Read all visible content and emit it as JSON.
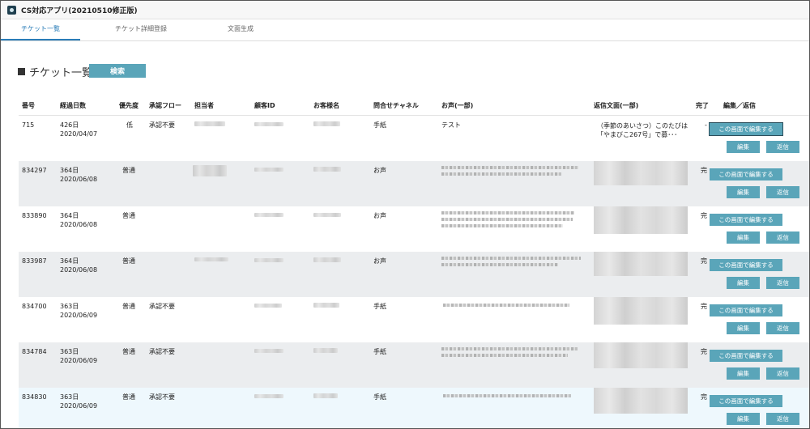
{
  "app": {
    "title": "CS対応アプリ(20210510修正版)"
  },
  "tabs": [
    {
      "label": "チケット一覧"
    },
    {
      "label": "チケット詳細登録"
    },
    {
      "label": "文面生成"
    }
  ],
  "page": {
    "title": "チケット一覧",
    "search_label": "検索"
  },
  "table": {
    "headers": [
      "番号",
      "経過日数",
      "優先度",
      "承認フロー",
      "担当者",
      "顧客ID",
      "お客様名",
      "問合せチャネル",
      "お声(一部)",
      "返信文面(一部)",
      "完了",
      "編集／返信"
    ],
    "buttons": {
      "edit_here": "この画面で編集する",
      "edit": "編集",
      "reply": "返信"
    },
    "rows": [
      {
        "number": "715",
        "days": "426日",
        "date": "2020/04/07",
        "priority": "低",
        "approval": "承認不要",
        "channel": "手紙",
        "voice": "テスト",
        "reply_line1": "（季節のあいさつ）このたびは",
        "reply_line2": "「やまびこ267号」で募･･･",
        "done": "-"
      },
      {
        "number": "834297",
        "days": "364日",
        "date": "2020/06/08",
        "priority": "普通",
        "approval": "",
        "channel": "お声",
        "voice": "",
        "reply_line1": "",
        "reply_line2": "",
        "done": "完"
      },
      {
        "number": "833890",
        "days": "364日",
        "date": "2020/06/08",
        "priority": "普通",
        "approval": "",
        "channel": "お声",
        "voice": "",
        "reply_line1": "",
        "reply_line2": "",
        "done": "完"
      },
      {
        "number": "833987",
        "days": "364日",
        "date": "2020/06/08",
        "priority": "普通",
        "approval": "",
        "channel": "お声",
        "voice": "",
        "reply_line1": "",
        "reply_line2": "",
        "done": "完"
      },
      {
        "number": "834700",
        "days": "363日",
        "date": "2020/06/09",
        "priority": "普通",
        "approval": "承認不要",
        "channel": "手紙",
        "voice": "",
        "reply_line1": "",
        "reply_line2": "",
        "done": "完"
      },
      {
        "number": "834784",
        "days": "363日",
        "date": "2020/06/09",
        "priority": "普通",
        "approval": "承認不要",
        "channel": "手紙",
        "voice": "",
        "reply_line1": "",
        "reply_line2": "",
        "done": "完"
      },
      {
        "number": "834830",
        "days": "363日",
        "date": "2020/06/09",
        "priority": "普通",
        "approval": "承認不要",
        "channel": "手紙",
        "voice": "",
        "reply_line1": "",
        "reply_line2": "",
        "done": "完"
      }
    ]
  },
  "colors": {
    "accent": "#5aa5b9",
    "active_tab": "#2a7db8",
    "alt_row": "#ebedef",
    "selected_row": "#eef8fd"
  }
}
